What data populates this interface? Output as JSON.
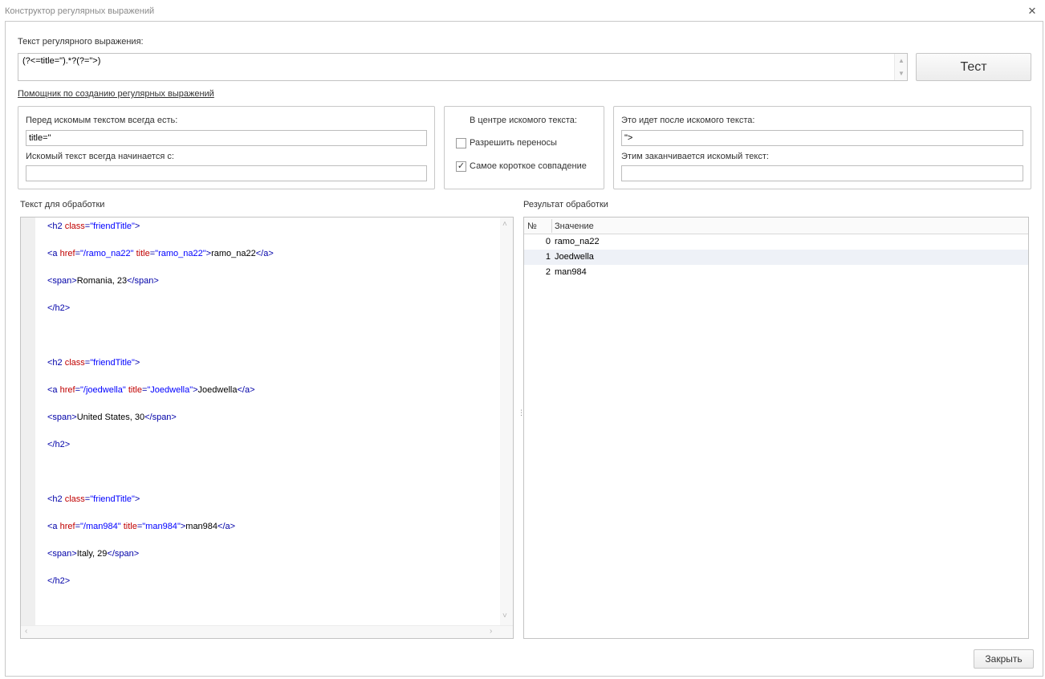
{
  "window": {
    "title": "Конструктор регулярных выражений",
    "close_glyph": "✕"
  },
  "regex": {
    "label": "Текст регулярного выражения:",
    "value": "(?<=title=\").*?(?=\">)",
    "test_button": "Тест",
    "helper_link": "Помощник по созданию регулярных выражений"
  },
  "before": {
    "label_always": "Перед искомым текстом всегда есть:",
    "value_always": "title=\"",
    "label_starts": "Искомый текст всегда начинается с:",
    "value_starts": ""
  },
  "center": {
    "label": "В центре искомого текста:",
    "allow_wrap": {
      "label": "Разрешить переносы",
      "checked": false
    },
    "shortest": {
      "label": "Самое короткое совпадение",
      "checked": true
    }
  },
  "after": {
    "label_after": "Это идет после искомого текста:",
    "value_after": "\">",
    "label_ends": "Этим заканчивается искомый текст:",
    "value_ends": ""
  },
  "source": {
    "label": "Текст для обработки",
    "blocks": [
      {
        "class_val": "friendTitle",
        "href": "/ramo_na22",
        "title": "ramo_na22",
        "link_text": "ramo_na22",
        "span_text": "Romania, 23"
      },
      {
        "class_val": "friendTitle",
        "href": "/joedwella",
        "title": "Joedwella",
        "link_text": "Joedwella",
        "span_text": "United States, 30"
      },
      {
        "class_val": "friendTitle",
        "href": "/man984",
        "title": "man984",
        "link_text": "man984",
        "span_text": "Italy, 29"
      }
    ]
  },
  "result": {
    "label": "Результат обработки",
    "columns": {
      "num": "№",
      "value": "Значение"
    },
    "rows": [
      {
        "num": "0",
        "value": "ramo_na22"
      },
      {
        "num": "1",
        "value": "Joedwella"
      },
      {
        "num": "2",
        "value": "man984"
      }
    ]
  },
  "footer": {
    "close_button": "Закрыть"
  },
  "icons": {
    "scroll_up": "▲",
    "scroll_down": "▼",
    "scroll_left": "◀",
    "scroll_right": "▶",
    "up_chevron": "˄",
    "down_chevron": "˅",
    "left_chevron": "‹",
    "right_chevron": "›",
    "grip": "⋮",
    "check": "✓"
  }
}
